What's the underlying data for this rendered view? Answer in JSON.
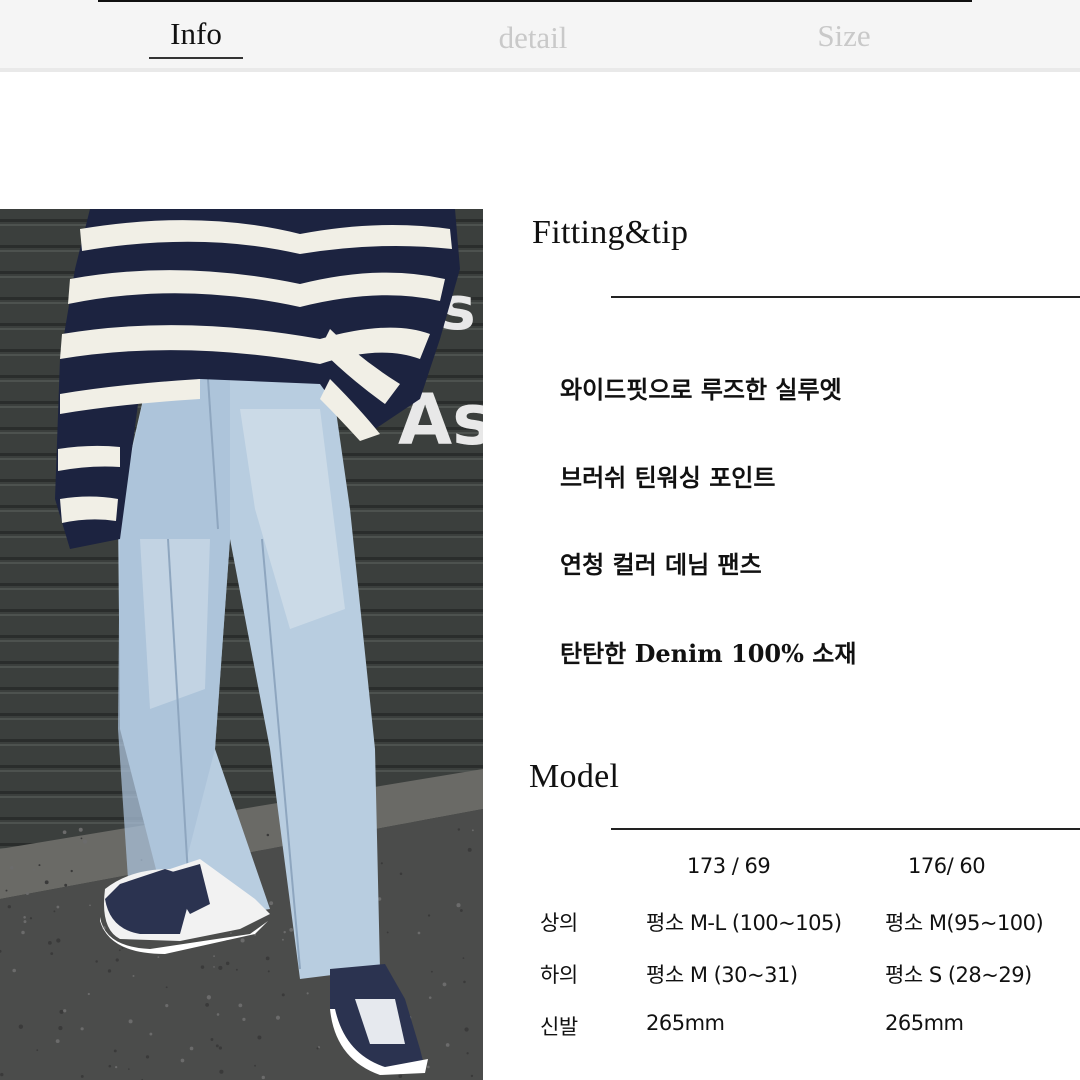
{
  "tabs": [
    {
      "label": "Info",
      "active": true
    },
    {
      "label": "detail",
      "active": false
    },
    {
      "label": "Size",
      "active": false
    }
  ],
  "photo": {
    "description": "Model wearing striped fuzzy sweater and light-wash wide denim pants with navy/white sneakers",
    "wall_sign_text": "As"
  },
  "fitting": {
    "title": "Fitting&tip",
    "tips": [
      "와이드핏으로 루즈한 실루엣",
      "브러쉬 틴워싱 포인트",
      "연청 컬러 데님 팬츠",
      "탄탄한 Denim 100% 소재"
    ]
  },
  "model": {
    "title": "Model",
    "columns": [
      "173 / 69",
      "176/ 60"
    ],
    "rows": [
      {
        "label": "상의",
        "values": [
          "평소 M-L (100~105)",
          "평소 M(95~100)"
        ]
      },
      {
        "label": "하의",
        "values": [
          "평소 M (30~31)",
          "평소 S (28~29)"
        ]
      },
      {
        "label": "신발",
        "values": [
          "265mm",
          "265mm"
        ]
      }
    ]
  },
  "colors": {
    "header_bg": "#f5f5f5",
    "active_tab": "#111111",
    "inactive_tab": "#c9c9c9",
    "sweater_navy": "#1c2340",
    "sweater_cream": "#f1efe6",
    "denim": "#b9cde0",
    "shutter": "#3a3d3b",
    "asphalt": "#4a4a4a"
  }
}
